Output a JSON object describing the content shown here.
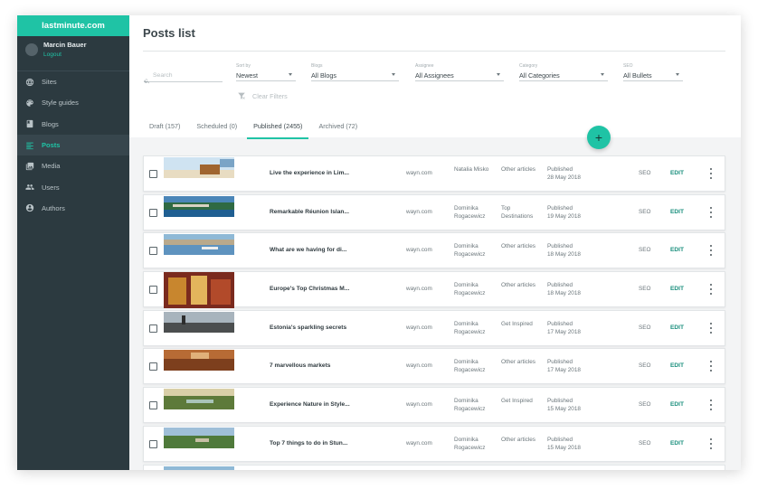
{
  "app": {
    "brand": "lastminute.com"
  },
  "user": {
    "name": "Marcin Bauer",
    "logout": "Logout"
  },
  "nav": [
    {
      "label": "Sites",
      "icon": "globe-icon"
    },
    {
      "label": "Style guides",
      "icon": "palette-icon"
    },
    {
      "label": "Blogs",
      "icon": "book-icon"
    },
    {
      "label": "Posts",
      "icon": "list-icon",
      "active": true
    },
    {
      "label": "Media",
      "icon": "image-icon"
    },
    {
      "label": "Users",
      "icon": "users-icon"
    },
    {
      "label": "Authors",
      "icon": "account-icon"
    }
  ],
  "page": {
    "title": "Posts list"
  },
  "filters": {
    "search_placeholder": "Search",
    "sort": {
      "label": "Sort by",
      "value": "Newest"
    },
    "blogs": {
      "label": "Blogs",
      "value": "All Blogs"
    },
    "assignee": {
      "label": "Assignee",
      "value": "All Assignees"
    },
    "category": {
      "label": "Category",
      "value": "All Categories"
    },
    "seo": {
      "label": "SEO",
      "value": "All Bullets"
    },
    "clear": "Clear Filters"
  },
  "tabs": [
    {
      "label": "Draft (157)"
    },
    {
      "label": "Scheduled (0)"
    },
    {
      "label": "Published (2455)",
      "active": true
    },
    {
      "label": "Archived (72)"
    }
  ],
  "fab": {
    "label": "+"
  },
  "rows": [
    {
      "title": "Live the experience in Lim...",
      "site": "wayn.com",
      "author": "Natalia Misko",
      "category": "Other articles",
      "status": "Published",
      "date": "28 May 2018",
      "seo": "SEO",
      "edit": "EDIT"
    },
    {
      "title": "Remarkable Réunion Islan...",
      "site": "wayn.com",
      "author": "Dominika Rogacewicz",
      "category": "Top Destinations",
      "status": "Published",
      "date": "19 May 2018",
      "seo": "SEO",
      "edit": "EDIT"
    },
    {
      "title": "What are we having for di...",
      "site": "wayn.com",
      "author": "Dominika Rogacewicz",
      "category": "Other articles",
      "status": "Published",
      "date": "18 May 2018",
      "seo": "SEO",
      "edit": "EDIT"
    },
    {
      "title": "Europe's Top Christmas M...",
      "site": "wayn.com",
      "author": "Dominika Rogacewicz",
      "category": "Other articles",
      "status": "Published",
      "date": "18 May 2018",
      "seo": "SEO",
      "edit": "EDIT"
    },
    {
      "title": "Estonia's sparkling secrets",
      "site": "wayn.com",
      "author": "Dominika Rogacewicz",
      "category": "Get Inspired",
      "status": "Published",
      "date": "17 May 2018",
      "seo": "SEO",
      "edit": "EDIT"
    },
    {
      "title": "7 marvellous markets",
      "site": "wayn.com",
      "author": "Dominika Rogacewicz",
      "category": "Other articles",
      "status": "Published",
      "date": "17 May 2018",
      "seo": "SEO",
      "edit": "EDIT"
    },
    {
      "title": "Experience Nature in Style...",
      "site": "wayn.com",
      "author": "Dominika Rogacewicz",
      "category": "Get Inspired",
      "status": "Published",
      "date": "15 May 2018",
      "seo": "SEO",
      "edit": "EDIT"
    },
    {
      "title": "Top 7 things to do in Stun...",
      "site": "wayn.com",
      "author": "Dominika Rogacewicz",
      "category": "Other articles",
      "status": "Published",
      "date": "15 May 2018",
      "seo": "SEO",
      "edit": "EDIT"
    }
  ]
}
